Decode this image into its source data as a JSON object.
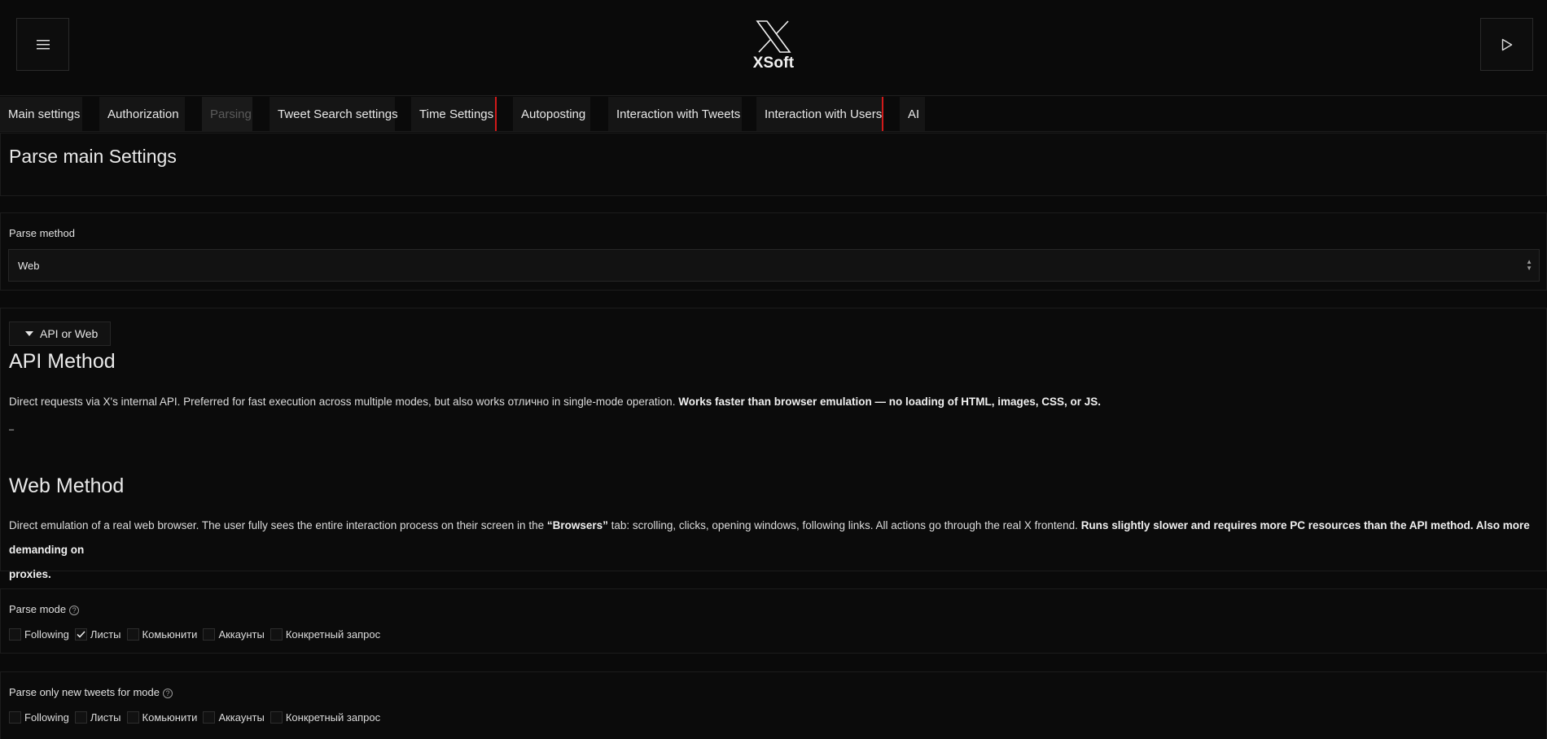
{
  "header": {
    "logo_text": "XSoft",
    "menu_icon": "hamburger-icon",
    "play_icon": "play-icon"
  },
  "tabs": [
    {
      "label": "Main settings"
    },
    {
      "label": "Authorization"
    },
    {
      "label": "Parsing",
      "active": true
    },
    {
      "label": "Tweet Search settings"
    },
    {
      "label": "Time Settings"
    },
    {
      "label": "Autoposting"
    },
    {
      "label": "Interaction with Tweets"
    },
    {
      "label": "Interaction with Users"
    },
    {
      "label": "AI"
    }
  ],
  "page_title": "Parse main Settings",
  "parse_method": {
    "label": "Parse method",
    "value": "Web"
  },
  "details": {
    "summary": "API or Web",
    "api_title": "API Method",
    "api_text_1": "Direct requests via X's internal API. Preferred for fast execution across multiple modes, but also works отлично in single-mode operation. ",
    "api_text_bold": "Works faster than browser emulation — no loading of HTML, images, CSS, or JS.",
    "api_dash": "–",
    "web_title": "Web Method",
    "web_text_1": "Direct emulation of a real web browser. The user fully sees the entire interaction process on their screen in the ",
    "web_text_browsers": "“Browsers”",
    "web_text_2": " tab: scrolling, clicks, opening windows, following links. All actions go through the real X frontend. ",
    "web_text_bold_1": "Runs slightly slower and requires more PC resources than the API method. Also more demanding on",
    "web_text_bold_2": "proxies."
  },
  "parse_mode": {
    "label": "Parse mode",
    "options": [
      {
        "label": "Following",
        "checked": false
      },
      {
        "label": "Листы",
        "checked": true
      },
      {
        "label": "Комьюнити",
        "checked": false
      },
      {
        "label": "Аккаунты",
        "checked": false
      },
      {
        "label": "Конкретный запрос",
        "checked": false
      }
    ]
  },
  "parse_new": {
    "label": "Parse only new tweets for mode",
    "options": [
      {
        "label": "Following",
        "checked": false
      },
      {
        "label": "Листы",
        "checked": false
      },
      {
        "label": "Комьюнити",
        "checked": false
      },
      {
        "label": "Аккаунты",
        "checked": false
      },
      {
        "label": "Конкретный запрос",
        "checked": false
      }
    ]
  },
  "colors": {
    "background": "#0a0a0a",
    "tab_divider": "#d11a1a"
  }
}
